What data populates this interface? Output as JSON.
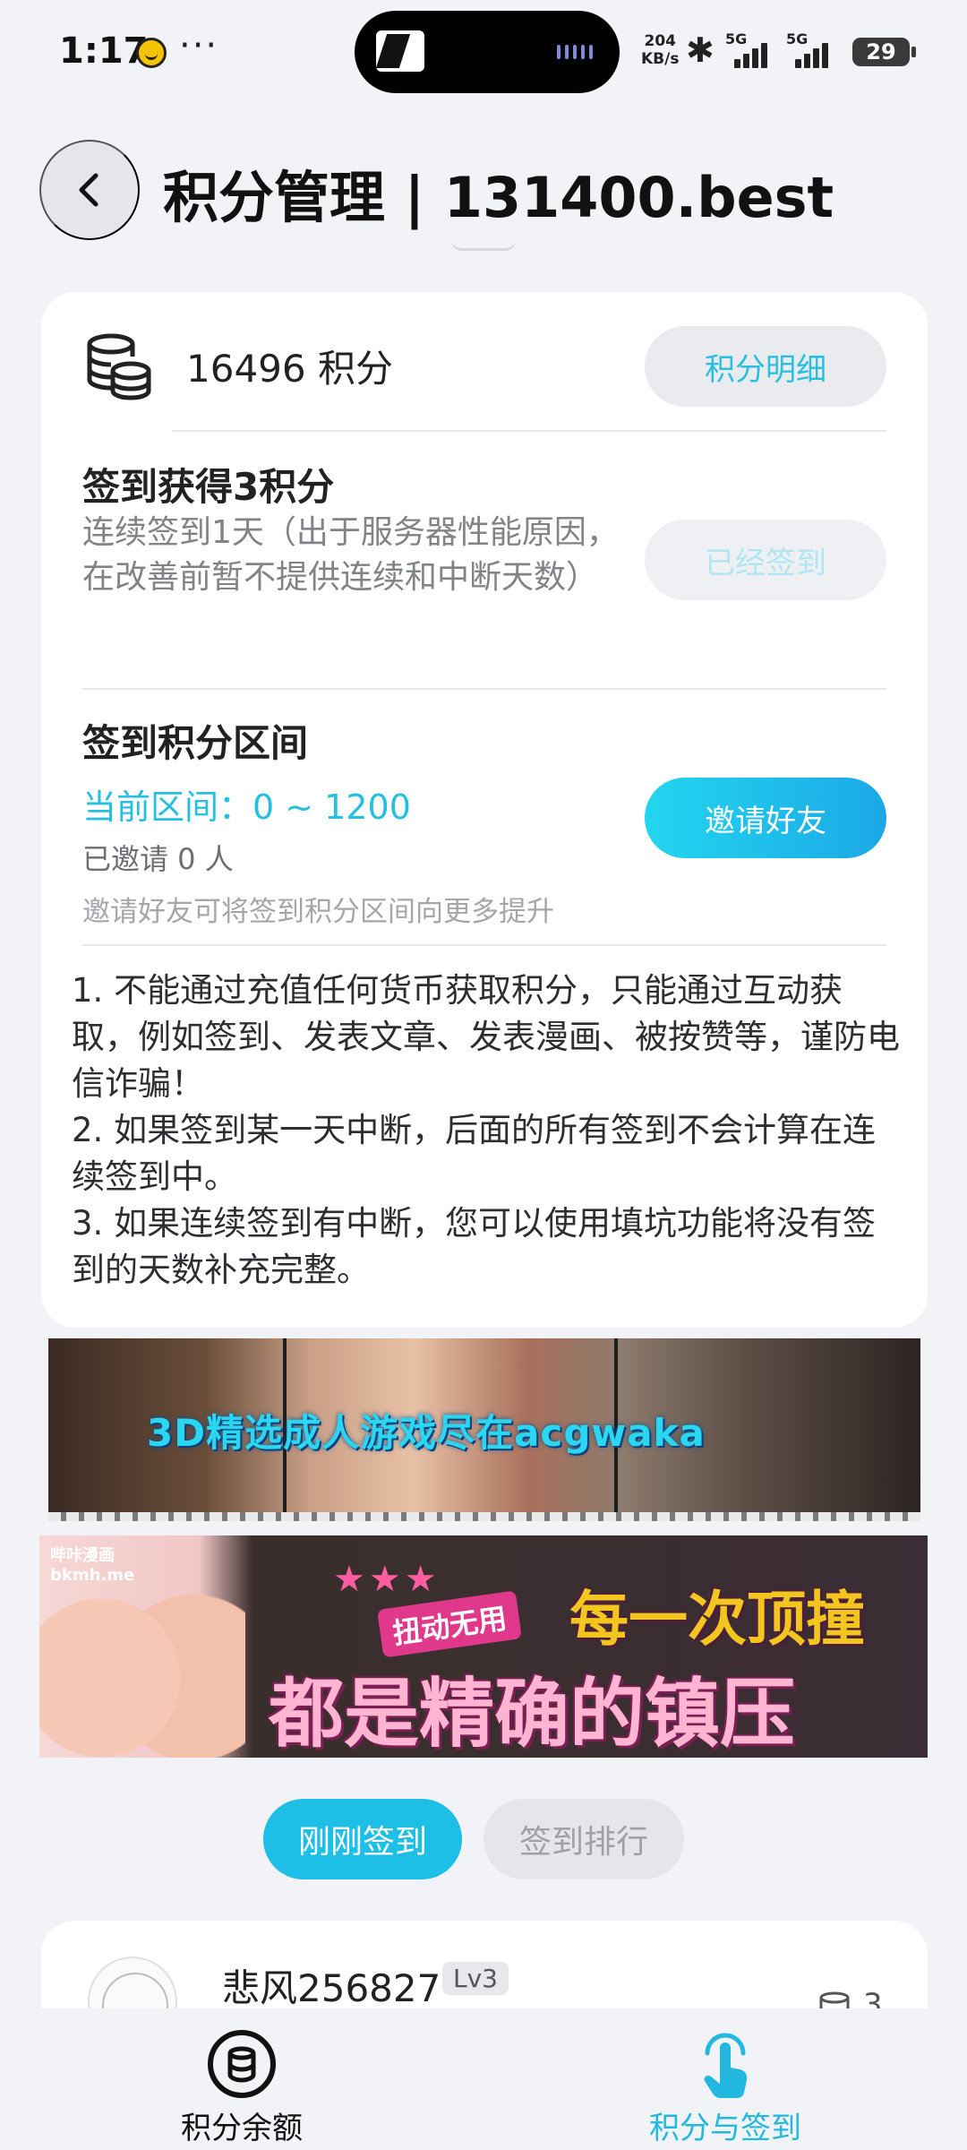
{
  "status_bar": {
    "time": "1:17",
    "net_speed_value": "204",
    "net_speed_unit": "KB/s",
    "signal_1_label": "5G",
    "signal_2_label": "5G",
    "battery": "29"
  },
  "header": {
    "title": "积分管理 | 131400.best"
  },
  "balance": {
    "text": "16496 积分",
    "detail_button": "积分明细"
  },
  "checkin": {
    "title": "签到获得3积分",
    "description": "连续签到1天（出于服务器性能原因，在改善前暂不提供连续和中断天数）",
    "signed_button": "已经签到"
  },
  "range": {
    "title": "签到积分区间",
    "current": "当前区间：0 ~ 1200",
    "invited": "已邀请 0 人",
    "hint": "邀请好友可将签到积分区间向更多提升",
    "invite_button": "邀请好友"
  },
  "rules": [
    "1. 不能通过充值任何货币获取积分，只能通过互动获取，例如签到、发表文章、发表漫画、被按赞等，谨防电信诈骗！",
    "2. 如果签到某一天中断，后面的所有签到不会计算在连续签到中。",
    "3. 如果连续签到有中断，您可以使用填坑功能将没有签到的天数补充完整。"
  ],
  "banners": {
    "banner1_text": "3D精选成人游戏尽在acgwaka",
    "banner2_logo": "哔咔漫画",
    "banner2_logo_sub": "bkmh.me",
    "banner2_tag": "扭动无用",
    "banner2_line1": "每一次顶撞",
    "banner2_line2": "都是精确的镇压"
  },
  "tabs": {
    "recent": "刚刚签到",
    "rank": "签到排行"
  },
  "list": [
    {
      "name": "悲风256827",
      "level": "Lv3",
      "points": "3"
    }
  ],
  "bottom_nav": {
    "balance_label": "积分余额",
    "checkin_label": "积分与签到"
  },
  "colors": {
    "accent": "#1dbfe6",
    "background": "#f1f3f6",
    "card": "#ffffff"
  }
}
